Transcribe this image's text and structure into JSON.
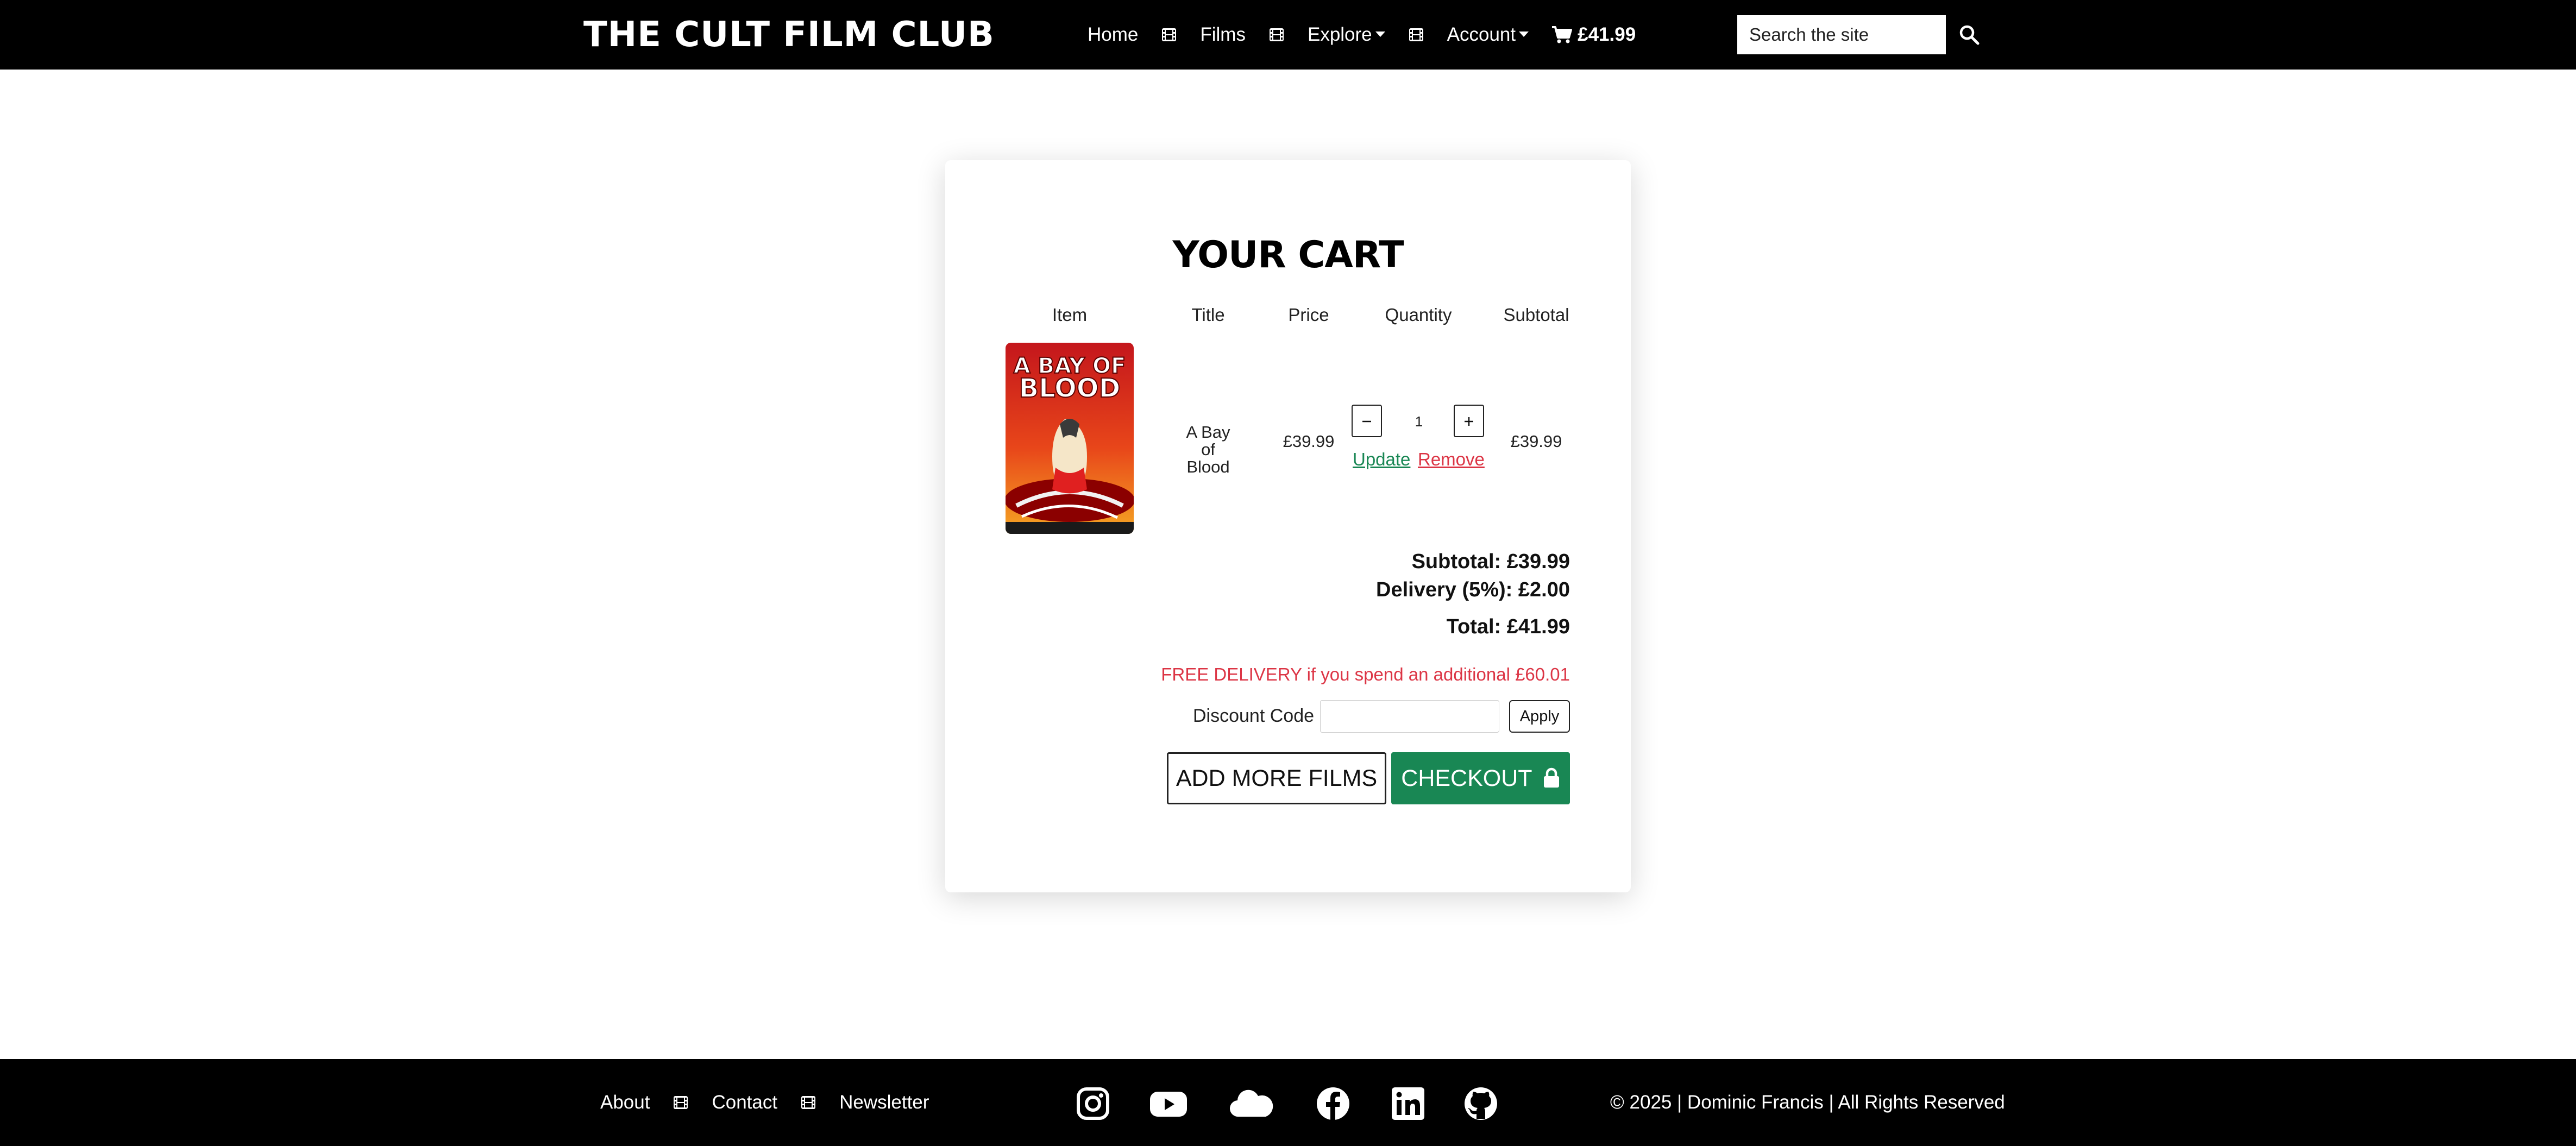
{
  "nav": {
    "brand": "THE CULT FILM CLUB",
    "links": {
      "home": "Home",
      "films": "Films",
      "explore": "Explore",
      "account": "Account"
    },
    "cart_total": "£41.99",
    "search_placeholder": "Search the site"
  },
  "cart": {
    "title": "YOUR CART",
    "headers": {
      "item": "Item",
      "title": "Title",
      "price": "Price",
      "quantity": "Quantity",
      "subtotal": "Subtotal"
    },
    "items": [
      {
        "title": "A Bay of Blood",
        "price": "£39.99",
        "quantity": "1",
        "subtotal": "£39.99",
        "poster_text_1": "A BAY OF",
        "poster_text_2": "BLOOD"
      }
    ],
    "update_label": "Update",
    "remove_label": "Remove",
    "summary": {
      "subtotal": "Subtotal: £39.99",
      "delivery": "Delivery (5%): £2.00",
      "total": "Total: £41.99"
    },
    "free_delivery_message": "FREE DELIVERY if you spend an additional £60.01",
    "discount_label": "Discount Code",
    "apply_label": "Apply",
    "add_more_label": "ADD MORE FILMS",
    "checkout_label": "CHECKOUT"
  },
  "footer": {
    "links": {
      "about": "About",
      "contact": "Contact",
      "newsletter": "Newsletter"
    },
    "social_icons": [
      "instagram-icon",
      "youtube-icon",
      "cloud-icon",
      "facebook-icon",
      "linkedin-icon",
      "github-icon"
    ],
    "copyright": "© 2025 | Dominic Francis | All Rights Reserved"
  },
  "colors": {
    "success": "#198754",
    "danger": "#dc3545",
    "nav_bg": "#000000"
  }
}
